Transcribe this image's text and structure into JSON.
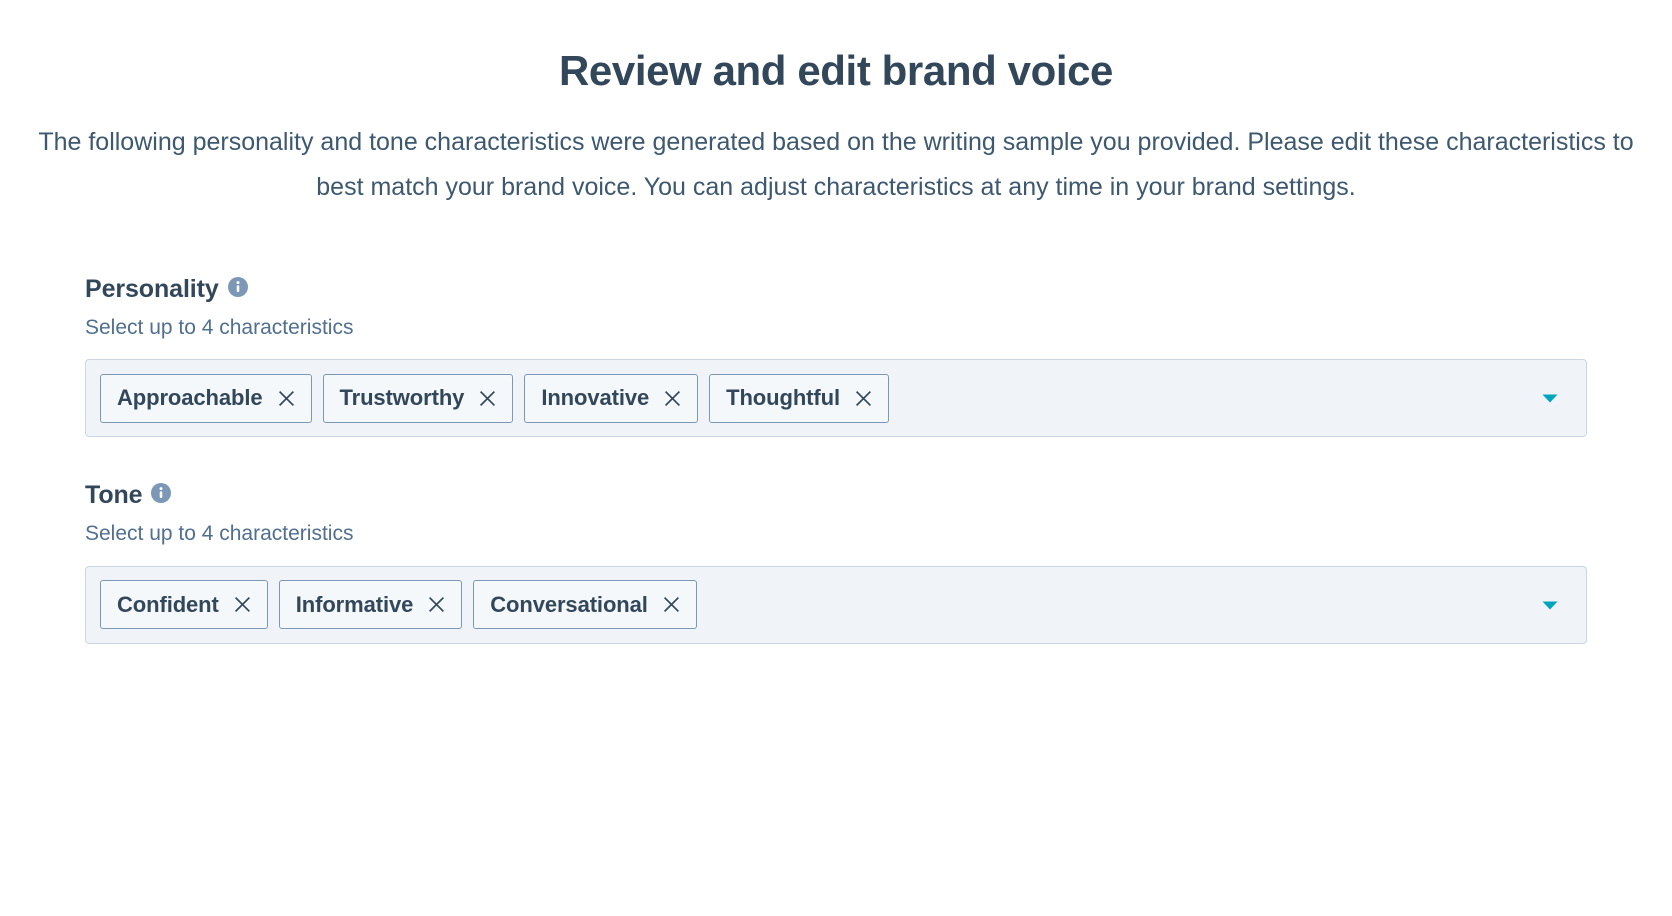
{
  "header": {
    "title": "Review and edit brand voice",
    "subtitle": "The following personality and tone characteristics were generated based on the writing sample you provided.  Please edit these characteristics to best match your brand voice. You can adjust characteristics at any time in your brand settings."
  },
  "colors": {
    "text_primary": "#33475b",
    "text_secondary": "#516f90",
    "field_background": "#f0f4f8",
    "field_border": "#cbd6e2",
    "token_border": "#7c98b6",
    "accent_teal": "#00a4bd",
    "info_icon": "#7c98b6"
  },
  "fields": [
    {
      "label": "Personality",
      "info_icon": "info-circle-icon",
      "help_text": "Select up to 4 characteristics",
      "caret_icon": "chevron-down-icon",
      "tokens": [
        {
          "label": "Approachable",
          "remove_icon": "close-icon"
        },
        {
          "label": "Trustworthy",
          "remove_icon": "close-icon"
        },
        {
          "label": "Innovative",
          "remove_icon": "close-icon"
        },
        {
          "label": "Thoughtful",
          "remove_icon": "close-icon"
        }
      ]
    },
    {
      "label": "Tone",
      "info_icon": "info-circle-icon",
      "help_text": "Select up to 4 characteristics",
      "caret_icon": "chevron-down-icon",
      "tokens": [
        {
          "label": "Confident",
          "remove_icon": "close-icon"
        },
        {
          "label": "Informative",
          "remove_icon": "close-icon"
        },
        {
          "label": "Conversational",
          "remove_icon": "close-icon"
        }
      ]
    }
  ]
}
